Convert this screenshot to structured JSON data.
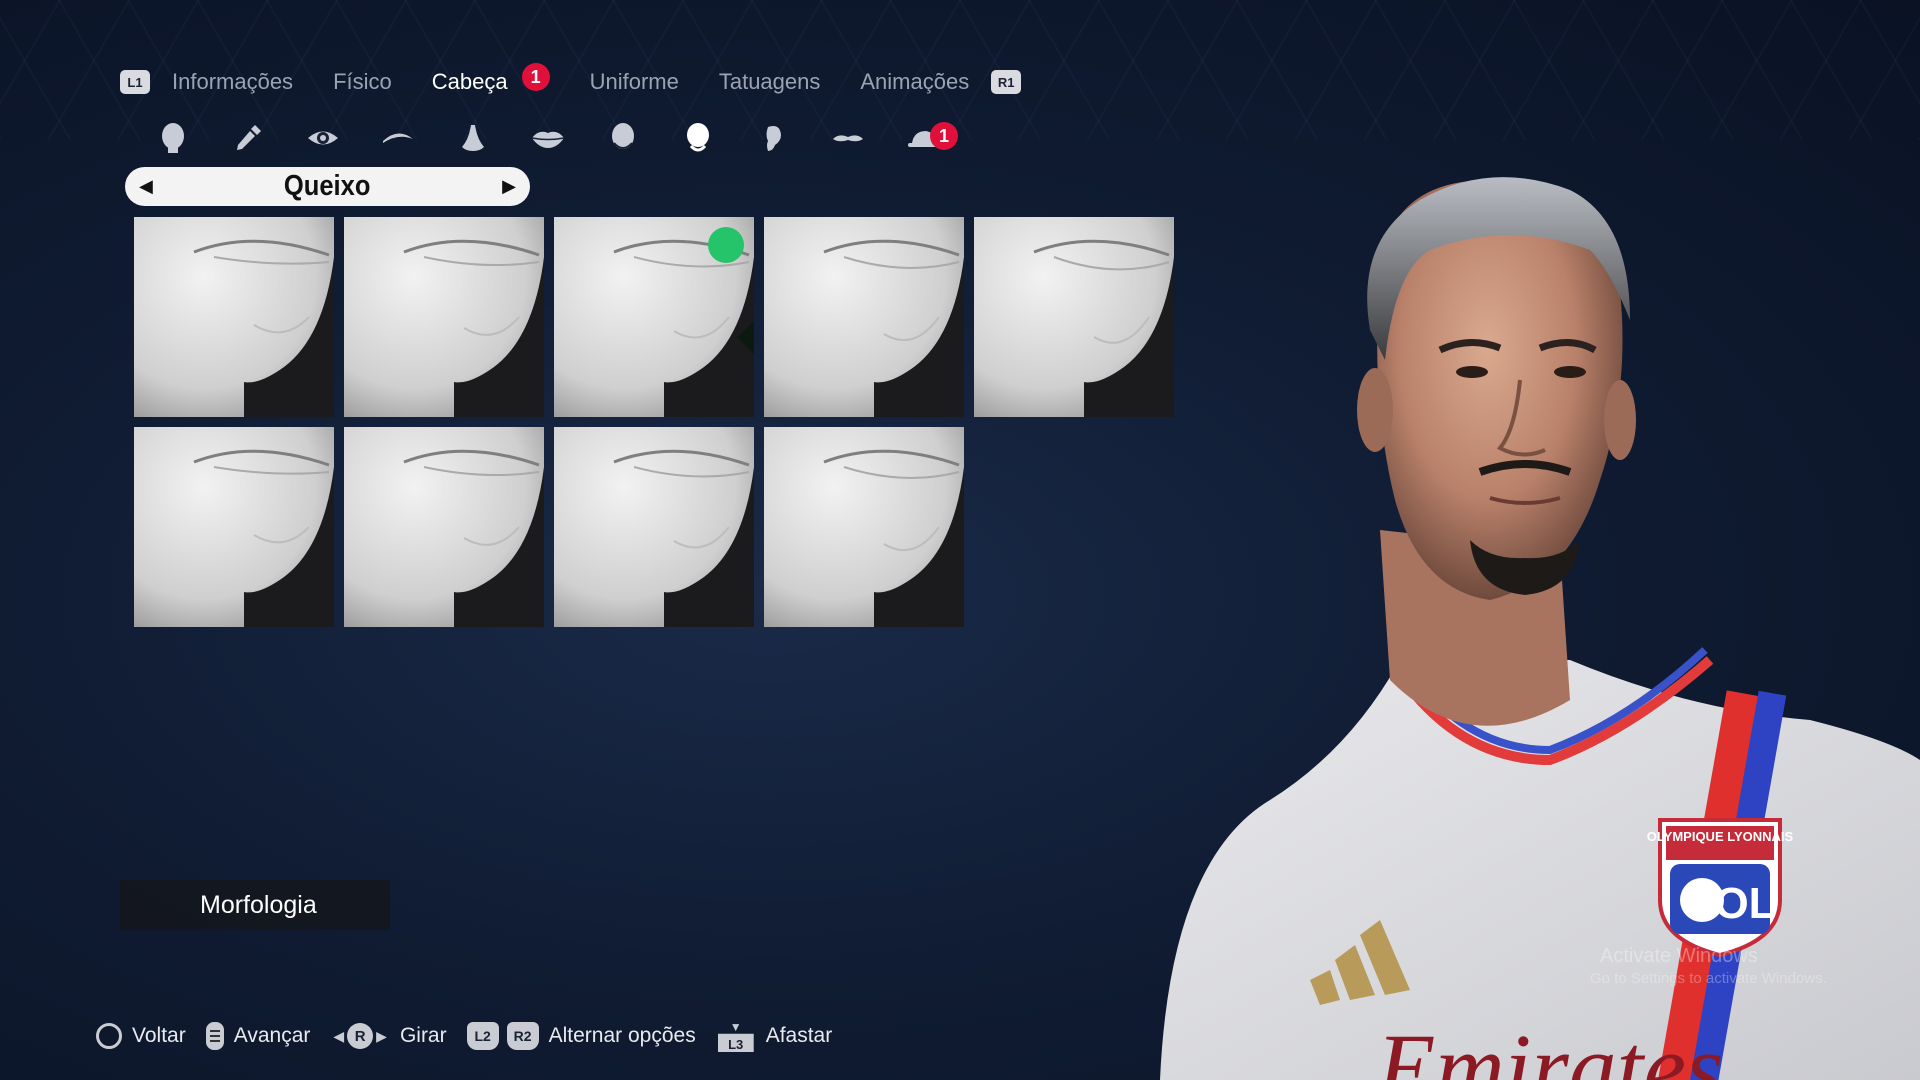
{
  "tabs": {
    "left_shoulder": "L1",
    "right_shoulder": "R1",
    "items": [
      {
        "label": "Informações"
      },
      {
        "label": "Físico"
      },
      {
        "label": "Cabeça",
        "badge": "1"
      },
      {
        "label": "Uniforme"
      },
      {
        "label": "Tatuagens"
      },
      {
        "label": "Animações"
      }
    ],
    "active_index": 2
  },
  "categories": {
    "icons": [
      "head-icon",
      "eyedropper-icon",
      "eye-icon",
      "eyebrow-icon",
      "nose-icon",
      "lips-icon",
      "face-shape-icon",
      "chin-icon",
      "ear-icon",
      "mustache-icon",
      "cap-icon"
    ],
    "active_icon": "chin-icon",
    "cap_badge": "1"
  },
  "selector": {
    "title": "Queixo",
    "prev": "◀",
    "next": "▶"
  },
  "grid": {
    "tile_count": 9,
    "selected_index": 2
  },
  "section_label": "Morfologia",
  "controls": [
    {
      "button": "circle",
      "label": "Voltar"
    },
    {
      "button": "options",
      "label": "Avançar"
    },
    {
      "button": "R",
      "label": "Girar"
    },
    {
      "button": "L2",
      "button2": "R2",
      "label": "Alternar opções"
    },
    {
      "button": "L3",
      "label": "Afastar"
    }
  ],
  "jersey": {
    "crest_text": "OLYMPIQUE LYONNAIS",
    "crest_initials": "OL",
    "sponsor": "Emirates"
  },
  "watermark": {
    "line1": "Activate Windows",
    "line2": "Go to Settings to activate Windows."
  },
  "colors": {
    "badge": "#e0103a",
    "check": "#25c36a",
    "active_tab": "#ffffff",
    "inactive_tab": "#9aa3b3"
  }
}
